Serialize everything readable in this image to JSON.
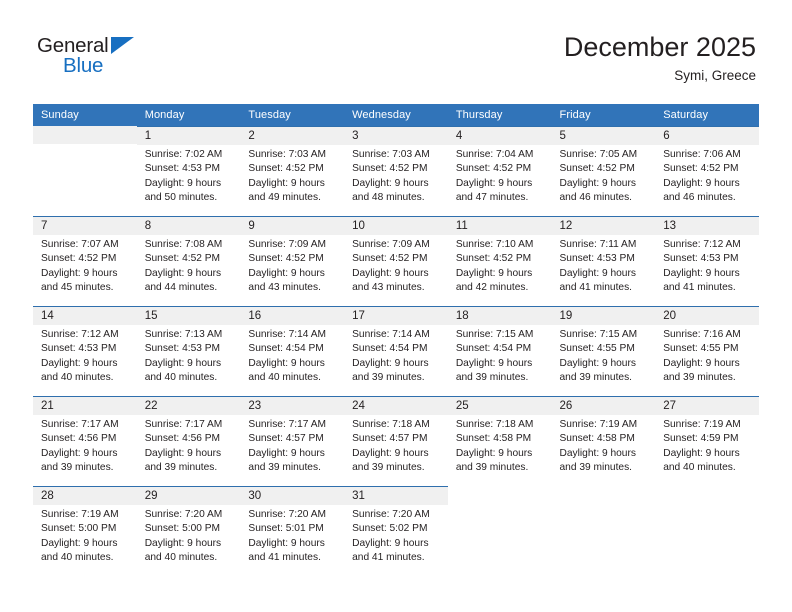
{
  "brand": {
    "name_part1": "General",
    "name_part2": "Blue",
    "flag_icon": "triangle-flag-icon"
  },
  "header": {
    "title": "December 2025",
    "subtitle": "Symi, Greece"
  },
  "colors": {
    "header_blue": "#3174b9",
    "row_line_blue": "#2f6fad",
    "daynum_band": "#f0f0f0",
    "brand_blue": "#176fc1",
    "text": "#231f20"
  },
  "weekdays": [
    "Sunday",
    "Monday",
    "Tuesday",
    "Wednesday",
    "Thursday",
    "Friday",
    "Saturday"
  ],
  "weeks": [
    [
      {
        "day": "",
        "sunrise": "",
        "sunset": "",
        "daylight_line1": "",
        "daylight_line2": "",
        "state": "empty"
      },
      {
        "day": "1",
        "sunrise": "Sunrise: 7:02 AM",
        "sunset": "Sunset: 4:53 PM",
        "daylight_line1": "Daylight: 9 hours",
        "daylight_line2": "and 50 minutes.",
        "state": "filled"
      },
      {
        "day": "2",
        "sunrise": "Sunrise: 7:03 AM",
        "sunset": "Sunset: 4:52 PM",
        "daylight_line1": "Daylight: 9 hours",
        "daylight_line2": "and 49 minutes.",
        "state": "filled"
      },
      {
        "day": "3",
        "sunrise": "Sunrise: 7:03 AM",
        "sunset": "Sunset: 4:52 PM",
        "daylight_line1": "Daylight: 9 hours",
        "daylight_line2": "and 48 minutes.",
        "state": "filled"
      },
      {
        "day": "4",
        "sunrise": "Sunrise: 7:04 AM",
        "sunset": "Sunset: 4:52 PM",
        "daylight_line1": "Daylight: 9 hours",
        "daylight_line2": "and 47 minutes.",
        "state": "filled"
      },
      {
        "day": "5",
        "sunrise": "Sunrise: 7:05 AM",
        "sunset": "Sunset: 4:52 PM",
        "daylight_line1": "Daylight: 9 hours",
        "daylight_line2": "and 46 minutes.",
        "state": "filled"
      },
      {
        "day": "6",
        "sunrise": "Sunrise: 7:06 AM",
        "sunset": "Sunset: 4:52 PM",
        "daylight_line1": "Daylight: 9 hours",
        "daylight_line2": "and 46 minutes.",
        "state": "filled"
      }
    ],
    [
      {
        "day": "7",
        "sunrise": "Sunrise: 7:07 AM",
        "sunset": "Sunset: 4:52 PM",
        "daylight_line1": "Daylight: 9 hours",
        "daylight_line2": "and 45 minutes.",
        "state": "filled"
      },
      {
        "day": "8",
        "sunrise": "Sunrise: 7:08 AM",
        "sunset": "Sunset: 4:52 PM",
        "daylight_line1": "Daylight: 9 hours",
        "daylight_line2": "and 44 minutes.",
        "state": "filled"
      },
      {
        "day": "9",
        "sunrise": "Sunrise: 7:09 AM",
        "sunset": "Sunset: 4:52 PM",
        "daylight_line1": "Daylight: 9 hours",
        "daylight_line2": "and 43 minutes.",
        "state": "filled"
      },
      {
        "day": "10",
        "sunrise": "Sunrise: 7:09 AM",
        "sunset": "Sunset: 4:52 PM",
        "daylight_line1": "Daylight: 9 hours",
        "daylight_line2": "and 43 minutes.",
        "state": "filled"
      },
      {
        "day": "11",
        "sunrise": "Sunrise: 7:10 AM",
        "sunset": "Sunset: 4:52 PM",
        "daylight_line1": "Daylight: 9 hours",
        "daylight_line2": "and 42 minutes.",
        "state": "filled"
      },
      {
        "day": "12",
        "sunrise": "Sunrise: 7:11 AM",
        "sunset": "Sunset: 4:53 PM",
        "daylight_line1": "Daylight: 9 hours",
        "daylight_line2": "and 41 minutes.",
        "state": "filled"
      },
      {
        "day": "13",
        "sunrise": "Sunrise: 7:12 AM",
        "sunset": "Sunset: 4:53 PM",
        "daylight_line1": "Daylight: 9 hours",
        "daylight_line2": "and 41 minutes.",
        "state": "filled"
      }
    ],
    [
      {
        "day": "14",
        "sunrise": "Sunrise: 7:12 AM",
        "sunset": "Sunset: 4:53 PM",
        "daylight_line1": "Daylight: 9 hours",
        "daylight_line2": "and 40 minutes.",
        "state": "filled"
      },
      {
        "day": "15",
        "sunrise": "Sunrise: 7:13 AM",
        "sunset": "Sunset: 4:53 PM",
        "daylight_line1": "Daylight: 9 hours",
        "daylight_line2": "and 40 minutes.",
        "state": "filled"
      },
      {
        "day": "16",
        "sunrise": "Sunrise: 7:14 AM",
        "sunset": "Sunset: 4:54 PM",
        "daylight_line1": "Daylight: 9 hours",
        "daylight_line2": "and 40 minutes.",
        "state": "filled"
      },
      {
        "day": "17",
        "sunrise": "Sunrise: 7:14 AM",
        "sunset": "Sunset: 4:54 PM",
        "daylight_line1": "Daylight: 9 hours",
        "daylight_line2": "and 39 minutes.",
        "state": "filled"
      },
      {
        "day": "18",
        "sunrise": "Sunrise: 7:15 AM",
        "sunset": "Sunset: 4:54 PM",
        "daylight_line1": "Daylight: 9 hours",
        "daylight_line2": "and 39 minutes.",
        "state": "filled"
      },
      {
        "day": "19",
        "sunrise": "Sunrise: 7:15 AM",
        "sunset": "Sunset: 4:55 PM",
        "daylight_line1": "Daylight: 9 hours",
        "daylight_line2": "and 39 minutes.",
        "state": "filled"
      },
      {
        "day": "20",
        "sunrise": "Sunrise: 7:16 AM",
        "sunset": "Sunset: 4:55 PM",
        "daylight_line1": "Daylight: 9 hours",
        "daylight_line2": "and 39 minutes.",
        "state": "filled"
      }
    ],
    [
      {
        "day": "21",
        "sunrise": "Sunrise: 7:17 AM",
        "sunset": "Sunset: 4:56 PM",
        "daylight_line1": "Daylight: 9 hours",
        "daylight_line2": "and 39 minutes.",
        "state": "filled"
      },
      {
        "day": "22",
        "sunrise": "Sunrise: 7:17 AM",
        "sunset": "Sunset: 4:56 PM",
        "daylight_line1": "Daylight: 9 hours",
        "daylight_line2": "and 39 minutes.",
        "state": "filled"
      },
      {
        "day": "23",
        "sunrise": "Sunrise: 7:17 AM",
        "sunset": "Sunset: 4:57 PM",
        "daylight_line1": "Daylight: 9 hours",
        "daylight_line2": "and 39 minutes.",
        "state": "filled"
      },
      {
        "day": "24",
        "sunrise": "Sunrise: 7:18 AM",
        "sunset": "Sunset: 4:57 PM",
        "daylight_line1": "Daylight: 9 hours",
        "daylight_line2": "and 39 minutes.",
        "state": "filled"
      },
      {
        "day": "25",
        "sunrise": "Sunrise: 7:18 AM",
        "sunset": "Sunset: 4:58 PM",
        "daylight_line1": "Daylight: 9 hours",
        "daylight_line2": "and 39 minutes.",
        "state": "filled"
      },
      {
        "day": "26",
        "sunrise": "Sunrise: 7:19 AM",
        "sunset": "Sunset: 4:58 PM",
        "daylight_line1": "Daylight: 9 hours",
        "daylight_line2": "and 39 minutes.",
        "state": "filled"
      },
      {
        "day": "27",
        "sunrise": "Sunrise: 7:19 AM",
        "sunset": "Sunset: 4:59 PM",
        "daylight_line1": "Daylight: 9 hours",
        "daylight_line2": "and 40 minutes.",
        "state": "filled"
      }
    ],
    [
      {
        "day": "28",
        "sunrise": "Sunrise: 7:19 AM",
        "sunset": "Sunset: 5:00 PM",
        "daylight_line1": "Daylight: 9 hours",
        "daylight_line2": "and 40 minutes.",
        "state": "filled"
      },
      {
        "day": "29",
        "sunrise": "Sunrise: 7:20 AM",
        "sunset": "Sunset: 5:00 PM",
        "daylight_line1": "Daylight: 9 hours",
        "daylight_line2": "and 40 minutes.",
        "state": "filled"
      },
      {
        "day": "30",
        "sunrise": "Sunrise: 7:20 AM",
        "sunset": "Sunset: 5:01 PM",
        "daylight_line1": "Daylight: 9 hours",
        "daylight_line2": "and 41 minutes.",
        "state": "filled"
      },
      {
        "day": "31",
        "sunrise": "Sunrise: 7:20 AM",
        "sunset": "Sunset: 5:02 PM",
        "daylight_line1": "Daylight: 9 hours",
        "daylight_line2": "and 41 minutes.",
        "state": "filled"
      },
      {
        "day": "",
        "sunrise": "",
        "sunset": "",
        "daylight_line1": "",
        "daylight_line2": "",
        "state": "blank"
      },
      {
        "day": "",
        "sunrise": "",
        "sunset": "",
        "daylight_line1": "",
        "daylight_line2": "",
        "state": "blank"
      },
      {
        "day": "",
        "sunrise": "",
        "sunset": "",
        "daylight_line1": "",
        "daylight_line2": "",
        "state": "blank"
      }
    ]
  ]
}
